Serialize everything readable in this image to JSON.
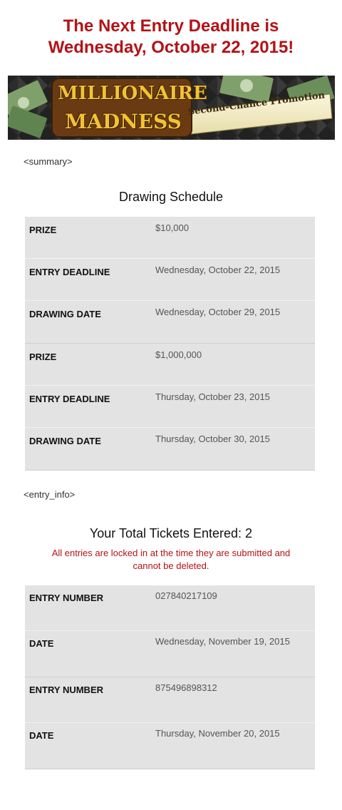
{
  "headline": {
    "line1": "The Next Entry Deadline is",
    "line2": "Wednesday, October 22, 2015!"
  },
  "banner": {
    "logo_line1": "MILLIONAIRE",
    "logo_line2": "MADNESS",
    "subtitle": "Second-Chance Promotion"
  },
  "summary_tag": "<summary>",
  "schedule": {
    "title": "Drawing Schedule",
    "groups": [
      {
        "prize_label": "PRIZE",
        "prize_value": "$10,000",
        "deadline_label": "ENTRY DEADLINE",
        "deadline_value": "Wednesday, October 22, 2015",
        "drawing_label": "DRAWING DATE",
        "drawing_value": "Wednesday, October 29, 2015"
      },
      {
        "prize_label": "PRIZE",
        "prize_value": "$1,000,000",
        "deadline_label": "ENTRY DEADLINE",
        "deadline_value": "Thursday, October 23, 2015",
        "drawing_label": "DRAWING DATE",
        "drawing_value": "Thursday, October 30, 2015"
      }
    ]
  },
  "entry_info_tag": "<entry_info>",
  "entries": {
    "title": "Your Total Tickets Entered: 2",
    "notice_line1": "All entries are locked in at the time they are submitted and",
    "notice_line2": "cannot be deleted.",
    "items": [
      {
        "number_label": "ENTRY NUMBER",
        "number_value": "027840217109",
        "date_label": "DATE",
        "date_value": "Wednesday, November 19, 2015"
      },
      {
        "number_label": "ENTRY NUMBER",
        "number_value": "875496898312",
        "date_label": "DATE",
        "date_value": "Thursday, November 20, 2015"
      }
    ]
  },
  "colors": {
    "accent_red": "#b31217",
    "table_bg": "#e3e3e3",
    "banner_gold": "#f2c233",
    "banner_green": "#6b8f5a"
  }
}
